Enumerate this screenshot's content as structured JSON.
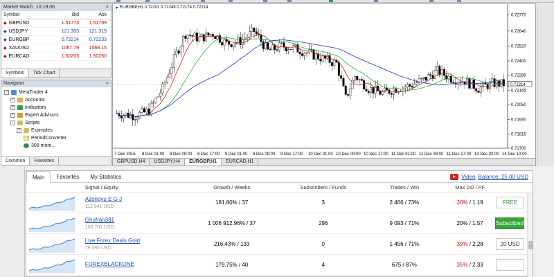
{
  "market_watch": {
    "title": "Market Watch: 10:19:00",
    "columns": {
      "symbol": "Symbol",
      "bid": "Bid",
      "ask": "Ask"
    },
    "rows": [
      {
        "symbol": "GBPUSD",
        "bid": "1.51773",
        "ask": "1.51789",
        "dir": "down"
      },
      {
        "symbol": "USDJPY",
        "bid": "121.303",
        "ask": "121.315",
        "dir": "up"
      },
      {
        "symbol": "EURGBP",
        "bid": "0.72214",
        "ask": "0.72233",
        "dir": "up"
      },
      {
        "symbol": "XAUUSD",
        "bid": "1067.79",
        "ask": "1068.15",
        "dir": "down"
      },
      {
        "symbol": "EURCAD",
        "bid": "1.50203",
        "ask": "1.50260",
        "dir": "down"
      }
    ],
    "tabs": [
      "Symbols",
      "Tick Chart"
    ]
  },
  "navigator": {
    "title": "Navigator",
    "items": [
      {
        "label": "MetaTrader 4",
        "level": 0,
        "icon": "metatrader-icon",
        "expander": "-"
      },
      {
        "label": "Accounts",
        "level": 1,
        "icon": "accounts-icon",
        "expander": "+"
      },
      {
        "label": "Indicators",
        "level": 1,
        "icon": "indicators-icon",
        "expander": "+"
      },
      {
        "label": "Expert Advisors",
        "level": 1,
        "icon": "expert-advisors-icon",
        "expander": "+"
      },
      {
        "label": "Scripts",
        "level": 1,
        "icon": "scripts-icon",
        "expander": "-"
      },
      {
        "label": "Examples",
        "level": 2,
        "icon": "folder-icon",
        "expander": "+"
      },
      {
        "label": "PeriodConverter",
        "level": 2,
        "icon": "script-file-icon",
        "expander": ""
      },
      {
        "label": "308 more...",
        "level": 2,
        "icon": "globe-icon",
        "expander": ""
      }
    ],
    "tabs": [
      "Common",
      "Favorites"
    ]
  },
  "chart": {
    "header": "EURGBP,H1  0.72201 0.72249 0.72174 0.72214",
    "price_label": "0.72214",
    "price_ticks": [
      "0.72770",
      "0.72640",
      "0.72520",
      "0.72400",
      "0.72285",
      "0.72165",
      "0.72050",
      "0.71930",
      "0.71815",
      "0.71700"
    ],
    "time_ticks": [
      "7 Dec 2015",
      "8 Dec 01:00",
      "8 Dec 09:00",
      "8 Dec 17:00",
      "9 Dec 01:00",
      "9 Dec 09:00",
      "9 Dec 17:00",
      "10 Dec 01:00",
      "10 Dec 09:00",
      "10 Dec 17:00",
      "11 Dec 01:00",
      "11 Dec 09:00",
      "11 Dec 17:00",
      "14 Dec 02:00",
      "14 Dec 10:00"
    ],
    "tabs": [
      "GBPUSD,H4",
      "USDJPY,H4",
      "EURGBP,H1",
      "EURCAD,H1"
    ],
    "active_tab": 2,
    "colors": {
      "ma_fast": "#d02020",
      "ma_mid": "#20b030",
      "ma_slow": "#2030c0",
      "bull": "#ffffff",
      "bear": "#000000"
    }
  },
  "signals": {
    "tabs": [
      "Main",
      "Favorites",
      "My Statistics"
    ],
    "video_label": "Video",
    "balance_label": "Balance: 25.00 USD",
    "columns": [
      "Signal / Equity",
      "Growth / Weeks",
      "Subscribers / Funds",
      "Trades / Win",
      "Max DD / PF"
    ],
    "rows": [
      {
        "name": "Azongyu E G J",
        "equity": "112 841 USD",
        "growth": "181.80% / 37",
        "subs": "3",
        "trades": "2 466 / 73%",
        "dd": "30%",
        "pf": " / 1.19",
        "dd_red": true,
        "button": "FREE",
        "button_type": "free"
      },
      {
        "name": "Ghufran381",
        "equity": "100 701 USD",
        "growth": "1 006 912.96% / 37",
        "subs": "296",
        "trades": "9 093 / 71%",
        "dd": "20%",
        "pf": " / 1.57",
        "dd_red": false,
        "button": "Subscribed",
        "button_type": "sub"
      },
      {
        "name": "Live Forex Deals Gold",
        "equity": "79 086 USD",
        "growth": "216.43% / 133",
        "subs": "0",
        "trades": "1 456 / 71%",
        "dd": "39%",
        "pf": " / 2.28",
        "dd_red": true,
        "button": "20 USD",
        "button_type": "price"
      },
      {
        "name": "FOREXBLACKONE",
        "equity": "",
        "growth": "179.75% / 40",
        "subs": "4",
        "trades": "675 / 87%",
        "dd": "35%",
        "pf": " / 2.33",
        "dd_red": true,
        "button": "",
        "button_type": "price"
      }
    ]
  }
}
